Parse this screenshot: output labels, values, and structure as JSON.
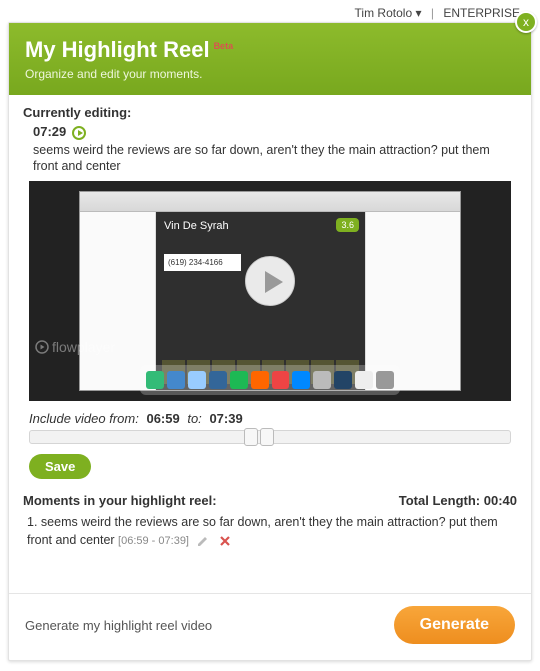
{
  "topbar": {
    "user": "Tim Rotolo",
    "caret": "▾",
    "link": "ENTERPRISE"
  },
  "header": {
    "title": "My Highlight Reel",
    "badge": "Beta",
    "subtitle": "Organize and edit your moments.",
    "close": "x"
  },
  "editing": {
    "label": "Currently editing:",
    "timestamp": "07:29",
    "description": "seems weird the reviews are so far down, aren't they the main attraction? put them front and center"
  },
  "video": {
    "site_title": "Vin De Syrah",
    "rating": "3.6",
    "phone": "(619) 234-4166",
    "watermark": "flowplayer"
  },
  "range": {
    "from_label": "Include video from:",
    "from_value": "06:59",
    "to_label": "to:",
    "to_value": "07:39"
  },
  "save_label": "Save",
  "moments": {
    "heading": "Moments in your highlight reel:",
    "total_label": "Total Length:",
    "total_value": "00:40",
    "items": [
      {
        "index": "1.",
        "text": "seems weird the reviews are so far down, aren't they the main attraction? put them front and center",
        "range": "[06:59 - 07:39]"
      }
    ]
  },
  "footer": {
    "text": "Generate my highlight reel video",
    "button": "Generate"
  }
}
